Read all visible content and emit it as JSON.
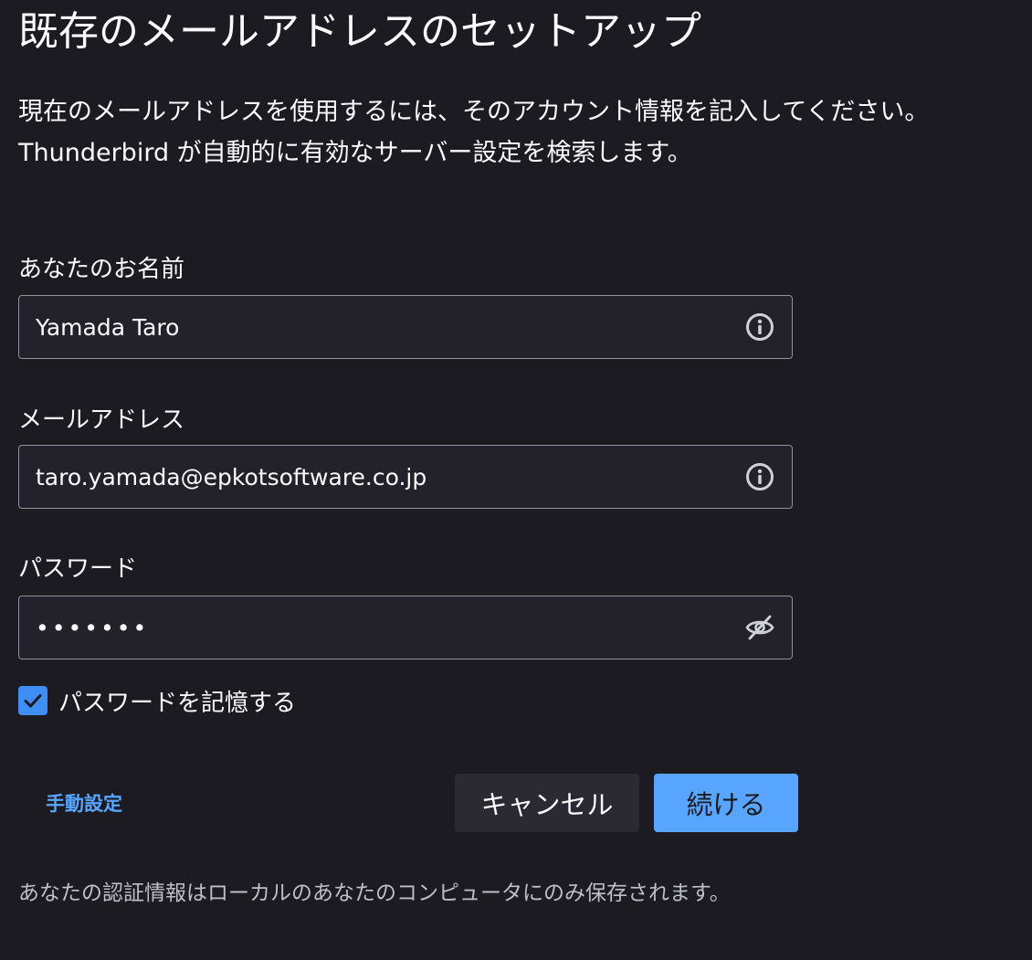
{
  "header": {
    "title": "既存のメールアドレスのセットアップ",
    "intro_line1": "現在のメールアドレスを使用するには、そのアカウント情報を記入してください。",
    "intro_line2": "Thunderbird が自動的に有効なサーバー設定を検索します。"
  },
  "form": {
    "name": {
      "label": "あなたのお名前",
      "value": "Yamada Taro",
      "icon": "info-icon"
    },
    "email": {
      "label": "メールアドレス",
      "value": "taro.yamada@epkotsoftware.co.jp",
      "icon": "info-icon"
    },
    "password": {
      "label": "パスワード",
      "value": "•••••••",
      "icon": "eye-slash-icon"
    },
    "remember": {
      "label": "パスワードを記憶する",
      "checked": true
    }
  },
  "actions": {
    "manual_config": "手動設定",
    "cancel": "キャンセル",
    "continue": "続ける"
  },
  "footer": {
    "note": "あなたの認証情報はローカルのあなたのコンピュータにのみ保存されます。"
  },
  "colors": {
    "background": "#1c1b22",
    "input_background": "#23222b",
    "accent": "#57a5ff",
    "checkbox": "#3f8ef5"
  }
}
